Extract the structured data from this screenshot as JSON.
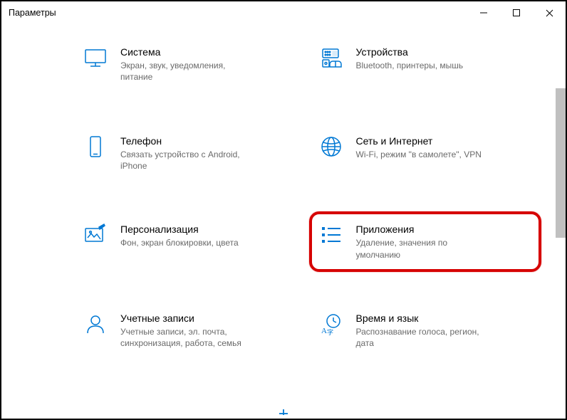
{
  "window": {
    "title": "Параметры"
  },
  "categories": [
    {
      "icon": "monitor-icon",
      "title": "Система",
      "subtitle": "Экран, звук, уведомления, питание"
    },
    {
      "icon": "devices-icon",
      "title": "Устройства",
      "subtitle": "Bluetooth, принтеры, мышь"
    },
    {
      "icon": "phone-icon",
      "title": "Телефон",
      "subtitle": "Связать устройство с Android, iPhone"
    },
    {
      "icon": "network-icon",
      "title": "Сеть и Интернет",
      "subtitle": "Wi-Fi, режим \"в самолете\", VPN"
    },
    {
      "icon": "personalization-icon",
      "title": "Персонализация",
      "subtitle": "Фон, экран блокировки, цвета"
    },
    {
      "icon": "apps-icon",
      "title": "Приложения",
      "subtitle": "Удаление, значения по умолчанию",
      "highlight": true
    },
    {
      "icon": "accounts-icon",
      "title": "Учетные записи",
      "subtitle": "Учетные записи, эл. почта, синхронизация, работа, семья"
    },
    {
      "icon": "time-language-icon",
      "title": "Время и язык",
      "subtitle": "Распознавание голоса, регион, дата"
    }
  ]
}
